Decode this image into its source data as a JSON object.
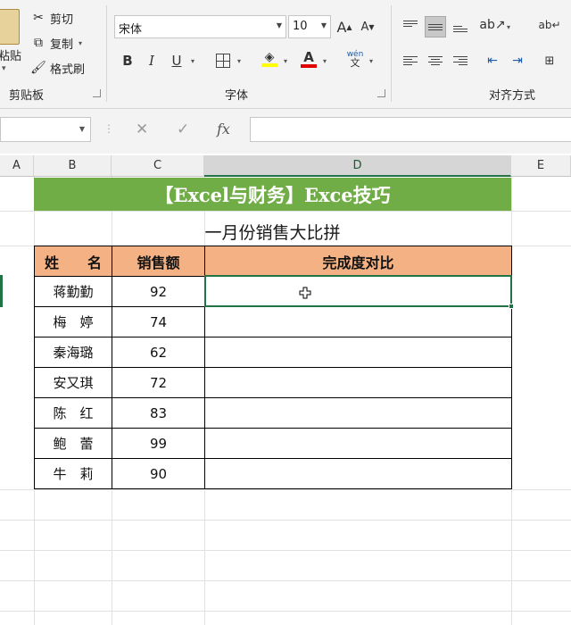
{
  "ribbon": {
    "clipboard": {
      "paste_label": "粘贴",
      "cut_label": "剪切",
      "copy_label": "复制",
      "format_painter_label": "格式刷",
      "group_label": "剪贴板"
    },
    "font": {
      "font_name": "宋体",
      "font_size": "10",
      "bold": "B",
      "italic": "I",
      "underline": "U",
      "increase_size": "A",
      "decrease_size": "A",
      "font_color_glyph": "A",
      "phonetic_glyph": "wén",
      "phonetic_sub": "文",
      "group_label": "字体"
    },
    "alignment": {
      "group_label": "对齐方式"
    }
  },
  "formula_bar": {
    "fx_label": "fx",
    "cancel_glyph": "✕",
    "confirm_glyph": "✓",
    "formula": ""
  },
  "columns": [
    "A",
    "B",
    "C",
    "D",
    "E"
  ],
  "sheet": {
    "banner": "【Excel与财务】Exce技巧",
    "subtitle": "一月份销售大比拼",
    "headers": {
      "name": "姓　　名",
      "sales": "销售额",
      "completion": "完成度对比"
    },
    "rows": [
      {
        "name": "蒋勤勤",
        "sales": "92"
      },
      {
        "name": "梅　婷",
        "sales": "74"
      },
      {
        "name": "秦海璐",
        "sales": "62"
      },
      {
        "name": "安又琪",
        "sales": "72"
      },
      {
        "name": "陈　红",
        "sales": "83"
      },
      {
        "name": "鲍　蕾",
        "sales": "99"
      },
      {
        "name": "牛　莉",
        "sales": "90"
      }
    ]
  },
  "colors": {
    "banner_bg": "#70ad47",
    "header_bg": "#f4b183",
    "selection": "#217346",
    "font_color_bar": "#e00000",
    "fill_color_bar": "#ffff00"
  }
}
